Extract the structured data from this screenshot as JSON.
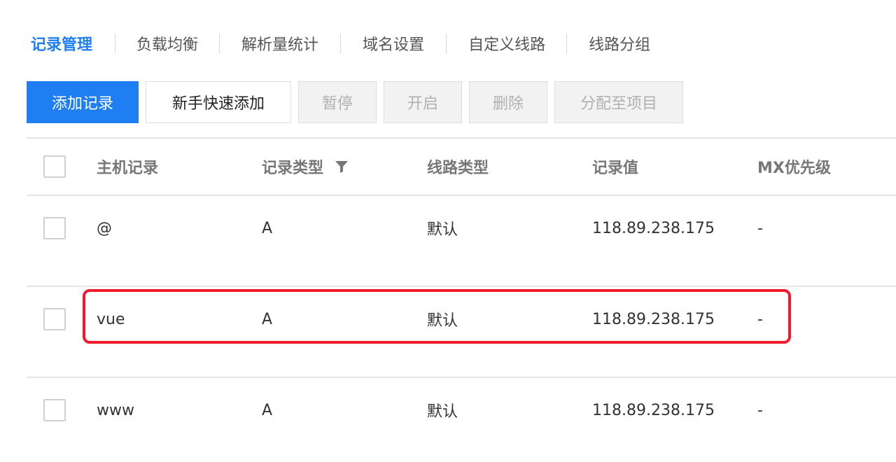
{
  "tabs": [
    {
      "label": "记录管理",
      "active": true
    },
    {
      "label": "负载均衡",
      "active": false
    },
    {
      "label": "解析量统计",
      "active": false
    },
    {
      "label": "域名设置",
      "active": false
    },
    {
      "label": "自定义线路",
      "active": false
    },
    {
      "label": "线路分组",
      "active": false
    }
  ],
  "toolbar": {
    "add_record": "添加记录",
    "quick_add": "新手快速添加",
    "pause": "暂停",
    "enable": "开启",
    "delete": "删除",
    "assign_project": "分配至项目"
  },
  "table": {
    "columns": {
      "host": "主机记录",
      "type": "记录类型",
      "line": "线路类型",
      "value": "记录值",
      "mx": "MX优先级"
    },
    "rows": [
      {
        "host": "@",
        "type": "A",
        "line": "默认",
        "value": "118.89.238.175",
        "mx": "-"
      },
      {
        "host": "vue",
        "type": "A",
        "line": "默认",
        "value": "118.89.238.175",
        "mx": "-"
      },
      {
        "host": "www",
        "type": "A",
        "line": "默认",
        "value": "118.89.238.175",
        "mx": "-"
      }
    ]
  },
  "colors": {
    "primary": "#1f7ef2",
    "highlight": "#ee1c2e"
  },
  "icons": {
    "filter": "filter-icon"
  }
}
